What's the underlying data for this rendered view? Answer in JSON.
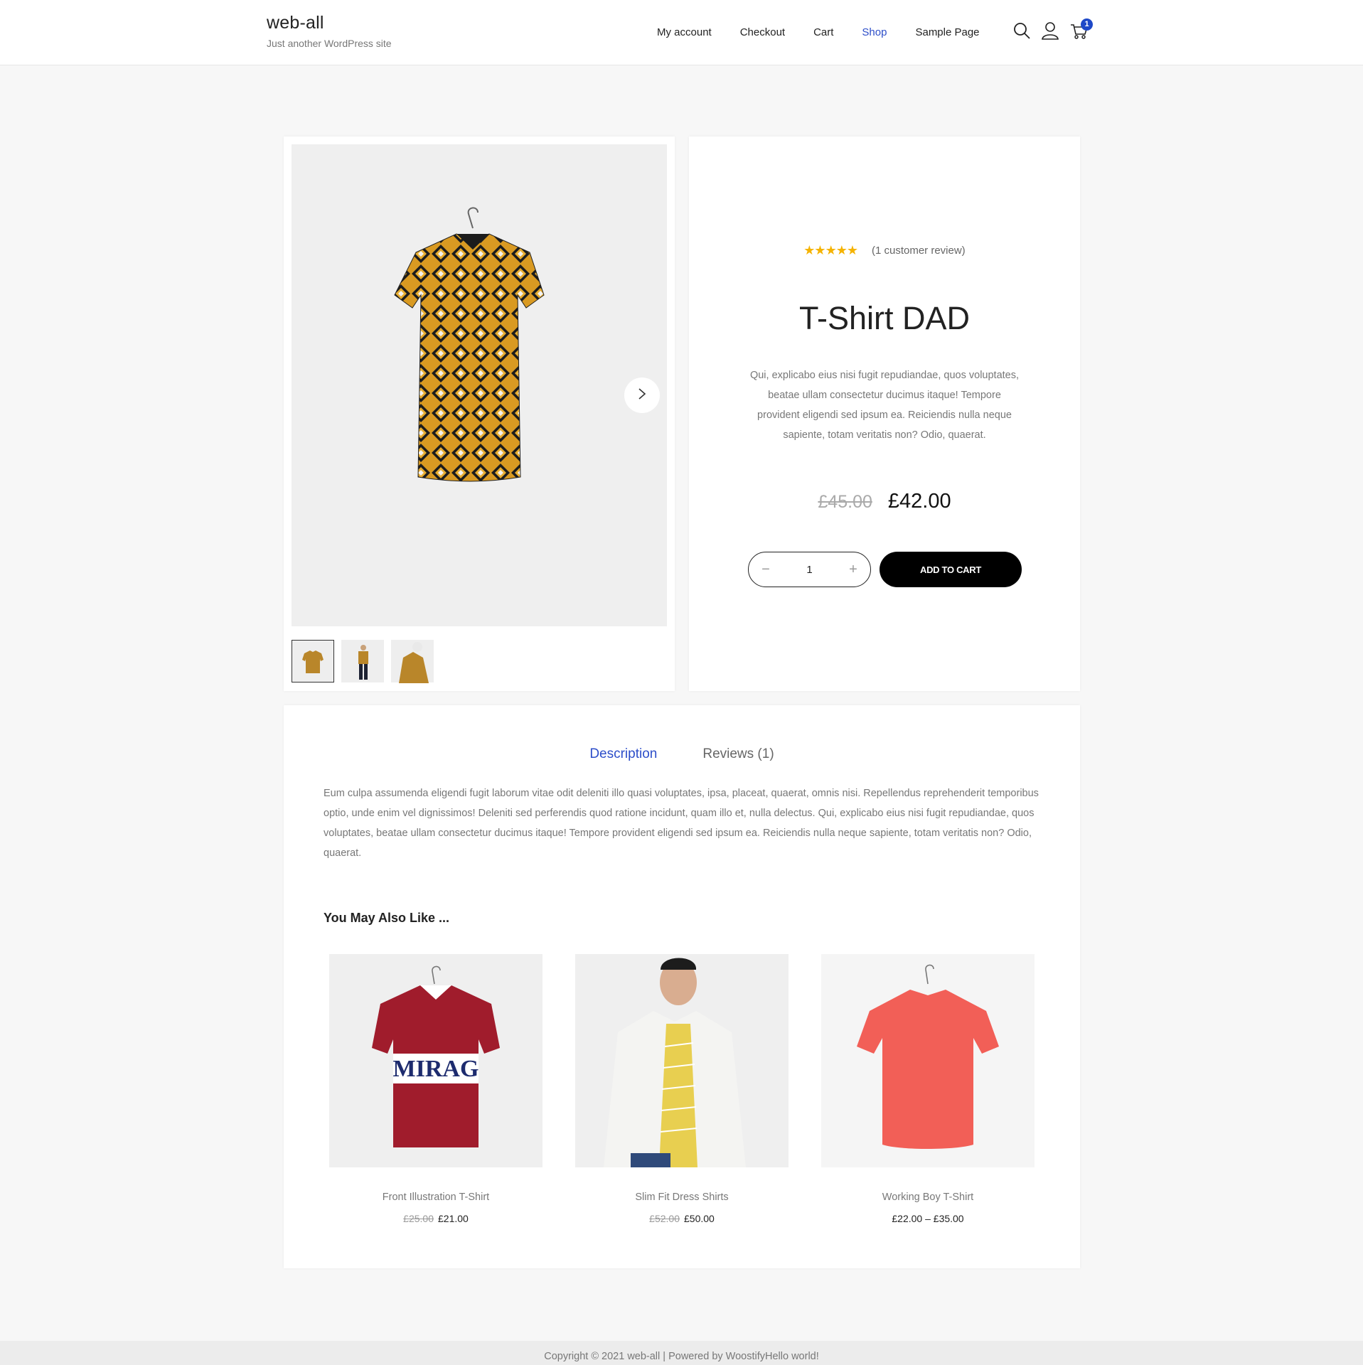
{
  "site": {
    "title": "web-all",
    "tagline": "Just another WordPress site"
  },
  "nav": {
    "items": [
      {
        "label": "My account",
        "active": false
      },
      {
        "label": "Checkout",
        "active": false
      },
      {
        "label": "Cart",
        "active": false
      },
      {
        "label": "Shop",
        "active": true
      },
      {
        "label": "Sample Page",
        "active": false
      }
    ],
    "icons": [
      "search-icon",
      "user-icon",
      "cart-icon"
    ],
    "cart_count": "1"
  },
  "product": {
    "stars": "★★★★★",
    "rating": 5,
    "review_count": "(1 customer review)",
    "title": "T-Shirt DAD",
    "short_description": "Qui, explicabo eius nisi fugit repudiandae, quos voluptates, beatae ullam consectetur ducimus itaque! Tempore provident eligendi sed ipsum ea. Reiciendis nulla neque sapiente, totam veritatis non? Odio, quaerat.",
    "price_old": "£45.00",
    "price_new": "£42.00",
    "quantity": "1",
    "add_to_cart": "ADD TO CART"
  },
  "tabs": {
    "description": "Description",
    "reviews": "Reviews (1)"
  },
  "description": "Eum culpa assumenda eligendi fugit laborum vitae odit deleniti illo quasi voluptates, ipsa, placeat, quaerat, omnis nisi. Repellendus reprehenderit temporibus optio, unde enim vel dignissimos! Deleniti sed perferendis quod ratione incidunt, quam illo et, nulla delectus. Qui, explicabo eius nisi fugit repudiandae, quos voluptates, beatae ullam consectetur ducimus itaque! Tempore provident eligendi sed ipsum ea. Reiciendis nulla neque sapiente, totam veritatis non? Odio, quaerat.",
  "related": {
    "title": "You May Also Like ...",
    "items": [
      {
        "name": "Front Illustration T-Shirt",
        "old": "£25.00",
        "price": "£21.00",
        "print": "MIRAG"
      },
      {
        "name": "Slim Fit Dress Shirts",
        "old": "£52.00",
        "price": "£50.00"
      },
      {
        "name": "Working Boy T-Shirt",
        "old": "",
        "price": "£22.00 – £35.00"
      }
    ]
  },
  "footer": "Copyright © 2021 web-all | Powered by WoostifyHello world!",
  "colors": {
    "accent": "#2d4ec9",
    "badge": "#1e48c8",
    "star": "#f5b301",
    "button": "#000000"
  }
}
